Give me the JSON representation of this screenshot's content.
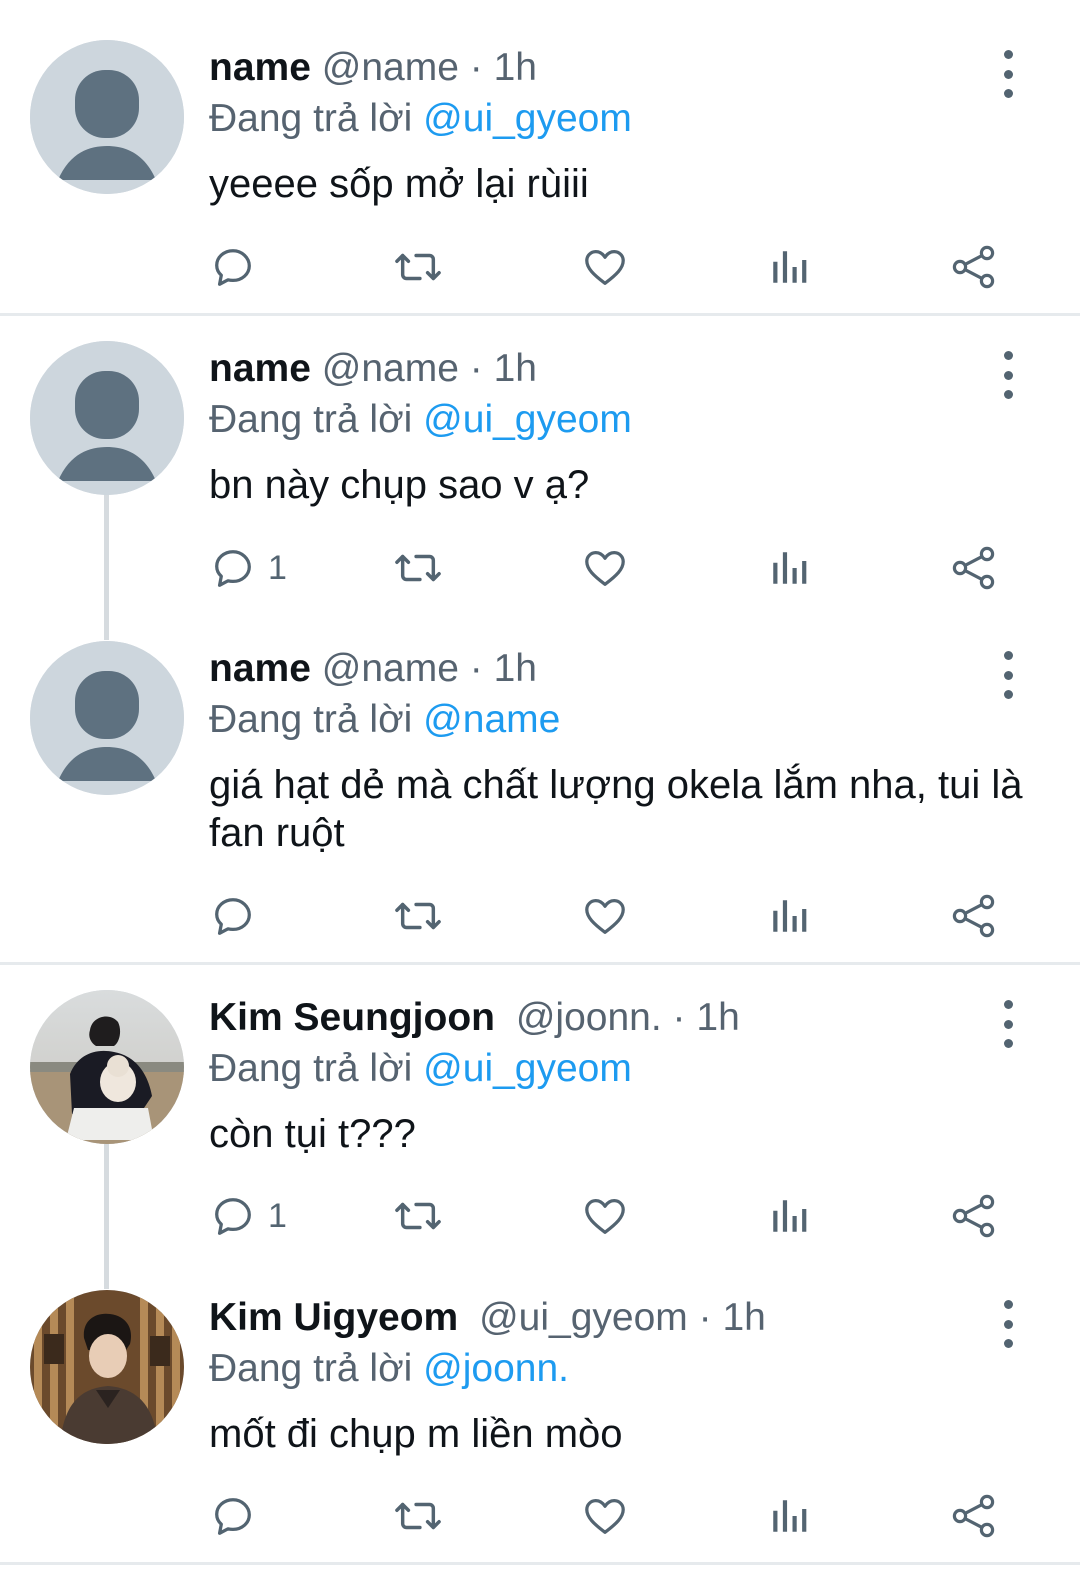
{
  "tweets": [
    {
      "name": "name",
      "handle": "@name",
      "time": "1h",
      "reply_prefix": "Đang trả lời",
      "reply_to": "@ui_gyeom",
      "text": "yeeee sốp mở lại rùiii",
      "reply_count": "",
      "avatar": "default-avatar"
    },
    {
      "name": "name",
      "handle": "@name",
      "time": "1h",
      "reply_prefix": "Đang trả lời",
      "reply_to": "@ui_gyeom",
      "text": "bn này chụp sao v ạ?",
      "reply_count": "1",
      "avatar": "default-avatar"
    },
    {
      "name": "name",
      "handle": "@name",
      "time": "1h",
      "reply_prefix": "Đang trả lời",
      "reply_to": "@name",
      "text": "giá hạt dẻ mà chất lượng okela lắm nha, tui là fan ruột",
      "reply_count": "",
      "avatar": "default-avatar"
    },
    {
      "name": "Kim Seungjoon",
      "handle": "@joonn.",
      "time": "1h",
      "reply_prefix": "Đang trả lời",
      "reply_to": "@ui_gyeom",
      "text": "còn tụi t???",
      "reply_count": "1",
      "avatar": "photo-avatar"
    },
    {
      "name": "Kim Uigyeom",
      "handle": "@ui_gyeom",
      "time": "1h",
      "reply_prefix": "Đang trả lời",
      "reply_to": "@joonn.",
      "text": "mốt đi chụp m liền mòo",
      "reply_count": "",
      "avatar": "photo-avatar"
    }
  ],
  "separator": "·",
  "colors": {
    "accent": "#1d9bf0",
    "muted": "#566370",
    "icon": "#536471",
    "divider": "#e6eaed"
  }
}
